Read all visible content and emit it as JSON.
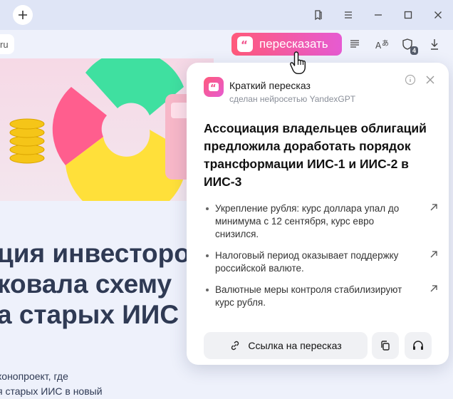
{
  "window": {
    "new_tab_icon": "plus-icon",
    "controls": [
      "bookmarks-icon",
      "menu-icon",
      "minimize-icon",
      "maximize-icon",
      "close-icon"
    ]
  },
  "toolbar": {
    "url_text": "ru",
    "retell_label": "пересказать",
    "tabs_badge": "4",
    "accent_gradient": [
      "#ff5a7a",
      "#e65bd2"
    ]
  },
  "page": {
    "headline_lines": [
      "ция инвесторо",
      "ковала схему",
      "а старых ИИС в"
    ],
    "sub_lines": [
      "конопроект, где",
      "я старых ИИС в новый"
    ]
  },
  "summary": {
    "title": "Краткий пересказ",
    "subtitle": "сделан нейросетью YandexGPT",
    "heading": "Ассоциация владельцев облигаций предложила доработать порядок трансформации ИИС-1 и ИИС-2 в ИИС-3",
    "bullets": [
      "Укрепление рубля: курс доллара упал до минимума с 12 сентября, курс евро снизился.",
      "Налоговый период оказывает поддержку российской валюте.",
      "Валютные меры контроля стабилизируют курс рубля."
    ],
    "link_button": "Ссылка на пересказ"
  }
}
